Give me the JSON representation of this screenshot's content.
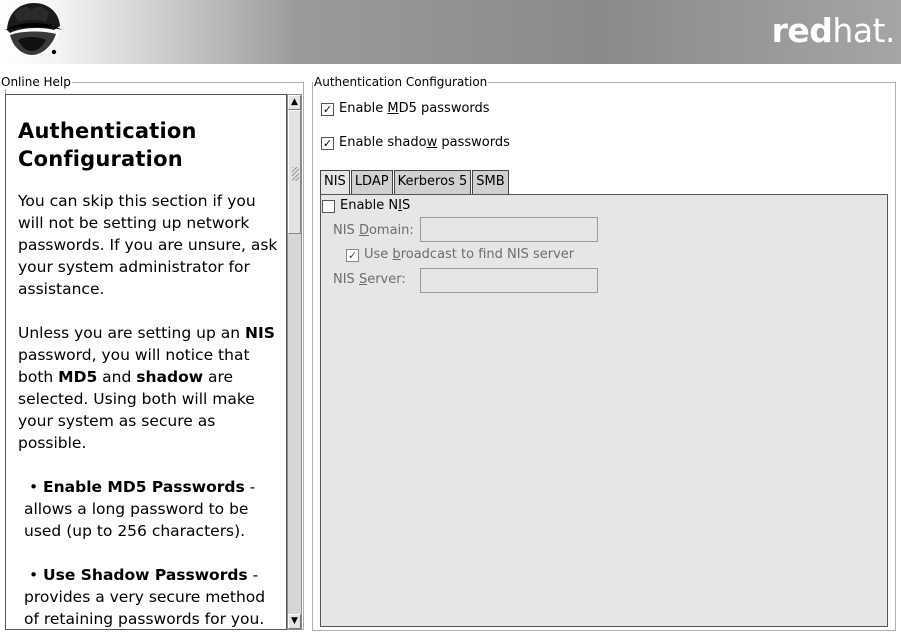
{
  "header": {
    "brand_bold": "red",
    "brand_light": "hat."
  },
  "help": {
    "frame_label": "Online Help",
    "title": "Authentication Configuration",
    "para1": "You can skip this section if you will not be setting up network passwords. If you are unsure, ask your system administrator for assistance.",
    "para2": {
      "t1": "Unless you are setting up an ",
      "b1": "NIS",
      "t2": " password, you will notice that both ",
      "b2": "MD5",
      "t3": " and ",
      "b3": "shadow",
      "t4": " are selected. Using both will make your system as secure as possible."
    },
    "bullet1": {
      "marker": "•",
      "title": "Enable MD5 Passwords",
      "text": " - allows a long password to be used (up to 256 characters)."
    },
    "bullet2": {
      "marker": "•",
      "title": "Use Shadow Passwords",
      "text": " - provides a very secure method of retaining passwords for you."
    },
    "scroll_up_glyph": "▲",
    "scroll_down_glyph": "▼"
  },
  "auth": {
    "frame_label": "Authentication Configuration",
    "md5": {
      "pre": "Enable ",
      "mnemonic": "M",
      "post": "D5 passwords",
      "checked": true,
      "mark": "✓"
    },
    "shadow": {
      "pre": "Enable shado",
      "mnemonic": "w",
      "post": " passwords",
      "checked": true,
      "mark": "✓"
    },
    "tabs": [
      {
        "label": "NIS",
        "active": true
      },
      {
        "label": "LDAP",
        "active": false
      },
      {
        "label": "Kerberos 5",
        "active": false
      },
      {
        "label": "SMB",
        "active": false
      }
    ],
    "nis": {
      "enable": {
        "pre": "Enable N",
        "mnemonic": "I",
        "post": "S",
        "checked": false
      },
      "domain_label": {
        "pre": "NIS ",
        "mnemonic": "D",
        "post": "omain:"
      },
      "domain_value": "",
      "broadcast": {
        "pre": "Use ",
        "mnemonic": "b",
        "post": "roadcast to find NIS server",
        "checked": true,
        "mark": "✓"
      },
      "server_label": {
        "pre": "NIS ",
        "mnemonic": "S",
        "post": "erver:"
      },
      "server_value": ""
    }
  },
  "colors": {
    "banner_dark": "#8a8a8a",
    "panel_bg": "#e6e6e6"
  }
}
